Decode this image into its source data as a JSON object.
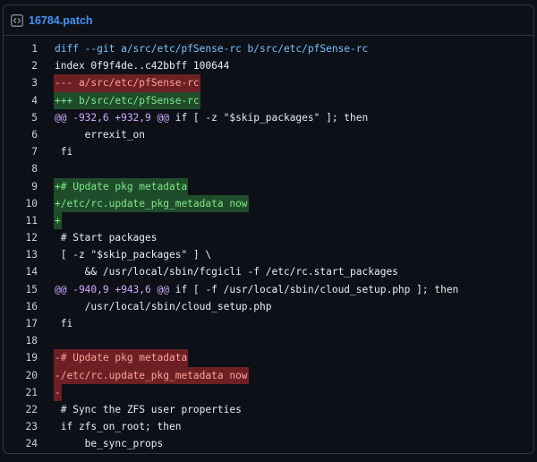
{
  "file": {
    "name": "16784.patch",
    "icon": "code-file-icon"
  },
  "colors": {
    "background": "#0d1117",
    "border": "#30363d",
    "link": "#4493f8",
    "header_text": "#79c0ff",
    "hunk_text": "#d2a8ff",
    "added_bg": "#1f4d2b",
    "added_fg": "#7ee787",
    "removed_bg": "#6d1f24",
    "removed_fg": "#ffa198"
  },
  "lines": [
    {
      "n": "1",
      "type": "hdr",
      "text": "diff --git a/src/etc/pfSense-rc b/src/etc/pfSense-rc"
    },
    {
      "n": "2",
      "type": "ctx",
      "text": "index 0f9f4de..c42bbff 100644"
    },
    {
      "n": "3",
      "type": "del",
      "text": "--- a/src/etc/pfSense-rc"
    },
    {
      "n": "4",
      "type": "add",
      "text": "+++ b/src/etc/pfSense-rc"
    },
    {
      "n": "5",
      "type": "hunk",
      "text": "@@ -932,6 +932,9 @@",
      "tail": " if [ -z \"$skip_packages\" ]; then"
    },
    {
      "n": "6",
      "type": "ctx",
      "text": "     errexit_on"
    },
    {
      "n": "7",
      "type": "ctx",
      "text": " fi"
    },
    {
      "n": "8",
      "type": "ctx",
      "text": " "
    },
    {
      "n": "9",
      "type": "add",
      "text": "+# Update pkg metadata"
    },
    {
      "n": "10",
      "type": "add",
      "text": "+/etc/rc.update_pkg_metadata now"
    },
    {
      "n": "11",
      "type": "add",
      "text": "+"
    },
    {
      "n": "12",
      "type": "ctx",
      "text": " # Start packages"
    },
    {
      "n": "13",
      "type": "ctx",
      "text": " [ -z \"$skip_packages\" ] \\"
    },
    {
      "n": "14",
      "type": "ctx",
      "text": "     && /usr/local/sbin/fcgicli -f /etc/rc.start_packages"
    },
    {
      "n": "15",
      "type": "hunk",
      "text": "@@ -940,9 +943,6 @@",
      "tail": " if [ -f /usr/local/sbin/cloud_setup.php ]; then"
    },
    {
      "n": "16",
      "type": "ctx",
      "text": "     /usr/local/sbin/cloud_setup.php"
    },
    {
      "n": "17",
      "type": "ctx",
      "text": " fi"
    },
    {
      "n": "18",
      "type": "ctx",
      "text": " "
    },
    {
      "n": "19",
      "type": "del",
      "text": "-# Update pkg metadata"
    },
    {
      "n": "20",
      "type": "del",
      "text": "-/etc/rc.update_pkg_metadata now"
    },
    {
      "n": "21",
      "type": "del",
      "text": "-"
    },
    {
      "n": "22",
      "type": "ctx",
      "text": " # Sync the ZFS user properties"
    },
    {
      "n": "23",
      "type": "ctx",
      "text": " if zfs_on_root; then"
    },
    {
      "n": "24",
      "type": "ctx",
      "text": "     be_sync_props"
    }
  ]
}
